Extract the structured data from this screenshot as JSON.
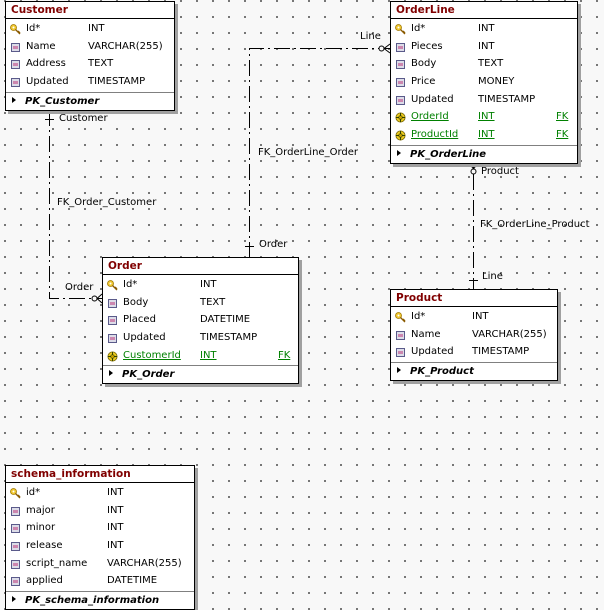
{
  "entities": {
    "customer": {
      "title": "Customer",
      "columns": [
        {
          "name": "Id*",
          "type": "INT",
          "icon": "primary-key-icon"
        },
        {
          "name": "Name",
          "type": "VARCHAR(255)",
          "icon": "field-icon"
        },
        {
          "name": "Address",
          "type": "TEXT",
          "icon": "field-icon"
        },
        {
          "name": "Updated",
          "type": "TIMESTAMP",
          "icon": "field-icon"
        }
      ],
      "pk": "PK_Customer"
    },
    "orderline": {
      "title": "OrderLine",
      "columns": [
        {
          "name": "Id*",
          "type": "INT",
          "icon": "primary-key-icon"
        },
        {
          "name": "Pieces",
          "type": "INT",
          "icon": "field-icon"
        },
        {
          "name": "Body",
          "type": "TEXT",
          "icon": "field-icon"
        },
        {
          "name": "Price",
          "type": "MONEY",
          "icon": "field-icon"
        },
        {
          "name": "Updated",
          "type": "TIMESTAMP",
          "icon": "field-icon"
        },
        {
          "name": "OrderId",
          "type": "INT",
          "fk": "FK",
          "icon": "foreign-key-icon"
        },
        {
          "name": "ProductId",
          "type": "INT",
          "fk": "FK",
          "icon": "foreign-key-icon"
        }
      ],
      "pk": "PK_OrderLine"
    },
    "order": {
      "title": "Order",
      "columns": [
        {
          "name": "Id*",
          "type": "INT",
          "icon": "primary-key-icon"
        },
        {
          "name": "Body",
          "type": "TEXT",
          "icon": "field-icon"
        },
        {
          "name": "Placed",
          "type": "DATETIME",
          "icon": "field-icon"
        },
        {
          "name": "Updated",
          "type": "TIMESTAMP",
          "icon": "field-icon"
        },
        {
          "name": "CustomerId",
          "type": "INT",
          "fk": "FK",
          "icon": "foreign-key-icon"
        }
      ],
      "pk": "PK_Order"
    },
    "product": {
      "title": "Product",
      "columns": [
        {
          "name": "Id*",
          "type": "INT",
          "icon": "primary-key-icon"
        },
        {
          "name": "Name",
          "type": "VARCHAR(255)",
          "icon": "field-icon"
        },
        {
          "name": "Updated",
          "type": "TIMESTAMP",
          "icon": "field-icon"
        }
      ],
      "pk": "PK_Product"
    },
    "schema_information": {
      "title": "schema_information",
      "columns": [
        {
          "name": "id*",
          "type": "INT",
          "icon": "primary-key-icon"
        },
        {
          "name": "major",
          "type": "INT",
          "icon": "field-icon"
        },
        {
          "name": "minor",
          "type": "INT",
          "icon": "field-icon"
        },
        {
          "name": "release",
          "type": "INT",
          "icon": "field-icon"
        },
        {
          "name": "script_name",
          "type": "VARCHAR(255)",
          "icon": "field-icon"
        },
        {
          "name": "applied",
          "type": "DATETIME",
          "icon": "field-icon"
        }
      ],
      "pk": "PK_schema_information"
    }
  },
  "relationships": {
    "fk_order_customer": {
      "name": "FK_Order_Customer",
      "parent_role": "Customer",
      "child_role": "Order"
    },
    "fk_orderline_order": {
      "name": "FK_OrderLine_Order",
      "parent_role": "Order",
      "child_role": "Line"
    },
    "fk_orderline_product": {
      "name": "FK_OrderLine_Product",
      "parent_role": "Product",
      "child_role": "Line"
    }
  },
  "colors": {
    "title": "#800000",
    "foreign_key": "#008000",
    "border": "#000000",
    "background": "#f8f8f8"
  }
}
